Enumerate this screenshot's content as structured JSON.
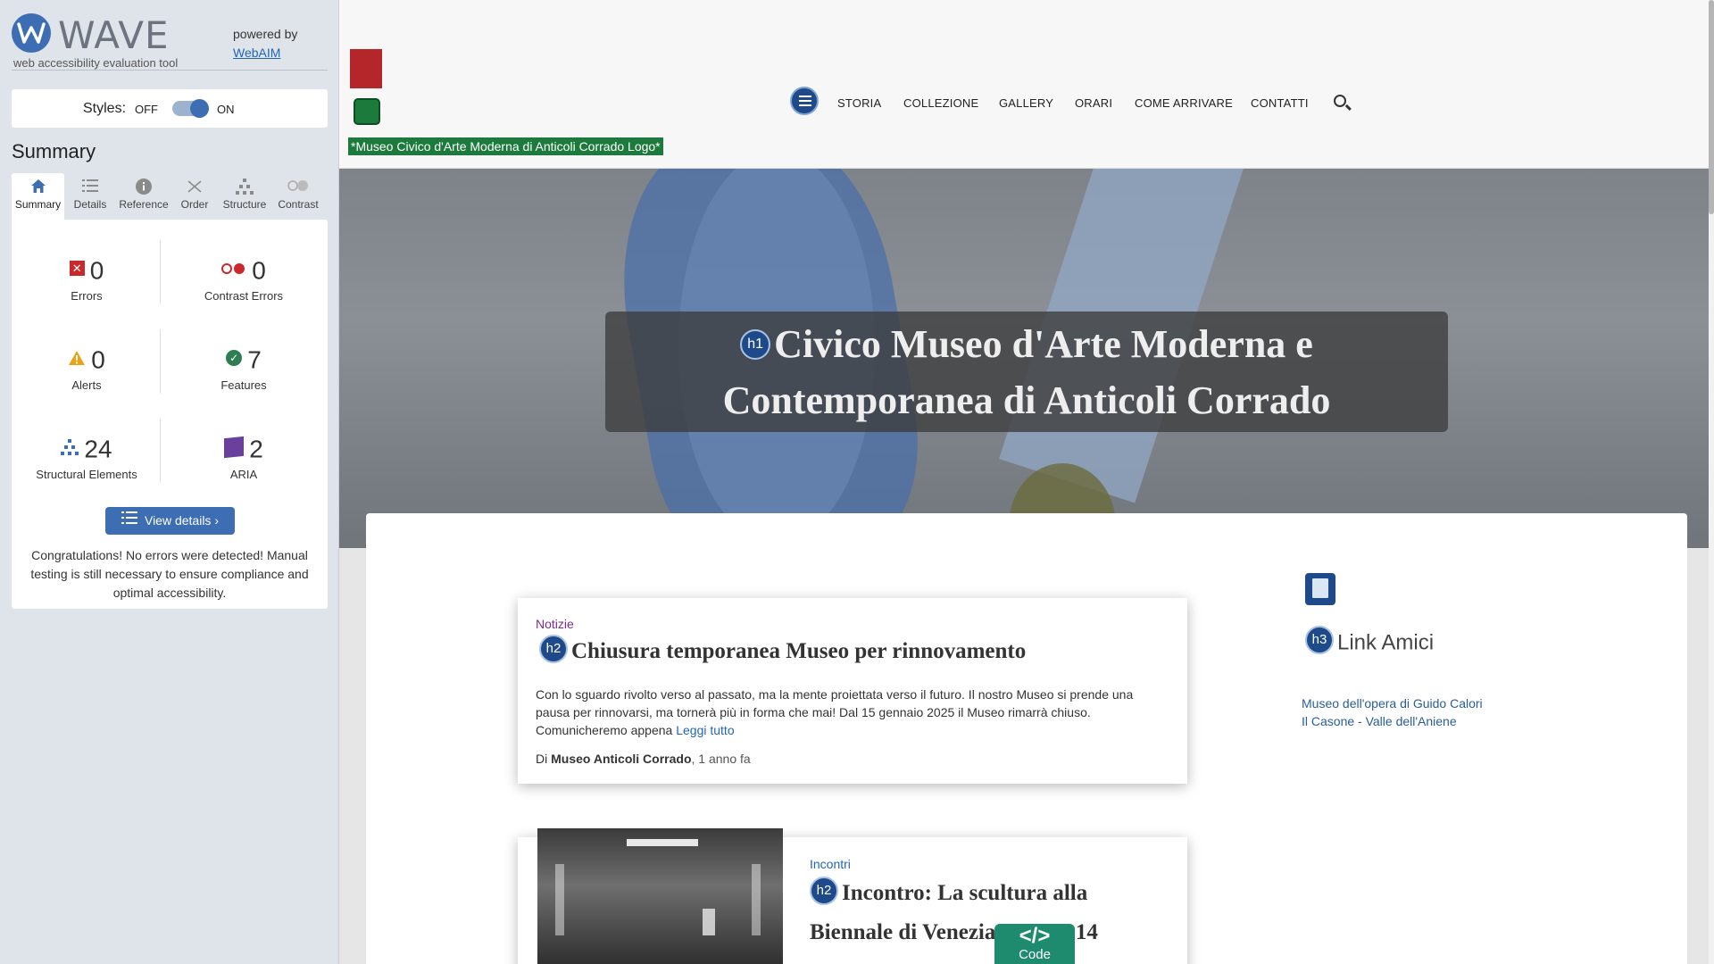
{
  "wave": {
    "brand": "WAVE",
    "tagline": "web accessibility evaluation tool",
    "powered_by": "powered by",
    "webaim": "WebAIM",
    "styles_label": "Styles:",
    "styles_off": "OFF",
    "styles_on": "ON",
    "styles_enabled": true,
    "summary_title": "Summary",
    "tabs": [
      {
        "label": "Summary",
        "icon": "home-icon",
        "active": true
      },
      {
        "label": "Details",
        "icon": "list-icon",
        "active": false
      },
      {
        "label": "Reference",
        "icon": "info-icon",
        "active": false
      },
      {
        "label": "Order",
        "icon": "order-icon",
        "active": false
      },
      {
        "label": "Structure",
        "icon": "structure-icon",
        "active": false
      },
      {
        "label": "Contrast",
        "icon": "contrast-icon",
        "active": false
      }
    ],
    "stats": {
      "errors": {
        "count": "0",
        "label": "Errors"
      },
      "contrast_errors": {
        "count": "0",
        "label": "Contrast Errors"
      },
      "alerts": {
        "count": "0",
        "label": "Alerts"
      },
      "features": {
        "count": "7",
        "label": "Features"
      },
      "structural": {
        "count": "24",
        "label": "Structural Elements"
      },
      "aria": {
        "count": "2",
        "label": "ARIA"
      }
    },
    "view_details": "View details ›",
    "congrats": "Congratulations! No errors were detected! Manual testing is still necessary to ensure compliance and optimal accessibility."
  },
  "site": {
    "logo_alt": "*Museo Civico d'Arte Moderna di Anticoli Corrado Logo*",
    "nav": [
      "STORIA",
      "COLLEZIONE",
      "GALLERY",
      "ORARI",
      "COME ARRIVARE",
      "CONTATTI"
    ],
    "hero_badge": "h1",
    "hero_title": "Civico Museo d'Arte Moderna e Contemporanea di Anticoli Corrado",
    "posts": [
      {
        "category": "Notizie",
        "badge": "h2",
        "title": "Chiusura temporanea Museo per rinnovamento",
        "excerpt": "Con lo sguardo rivolto verso al passato, ma la mente proiettata verso il futuro. Il nostro Museo si prende una pausa per rinnovarsi, ma tornerà più in forma che mai! Dal 15 gennaio 2025 il Museo rimarrà chiuso. Comunicheremo appena",
        "more": "Leggi tutto",
        "by": "Di",
        "author": "Museo Anticoli Corrado",
        "ago": ", 1 anno fa"
      },
      {
        "category": "Incontri",
        "badge": "h2",
        "title": "Incontro: La scultura alla Biennale di Venezia 1895-1914"
      }
    ],
    "aside": {
      "badge": "h3",
      "title": "Link Amici",
      "links": [
        "Museo dell'opera di Guido Calori",
        "Il Casone - Valle dell'Aniene"
      ]
    },
    "code_tab": {
      "glyph": "</>",
      "label": "Code"
    }
  },
  "colors": {
    "wave_blue": "#3d6eb3",
    "error_red": "#c9292a",
    "feature_green": "#2f7d52",
    "aria_purple": "#6a3f9e",
    "logo_green": "#1c7a3c"
  }
}
